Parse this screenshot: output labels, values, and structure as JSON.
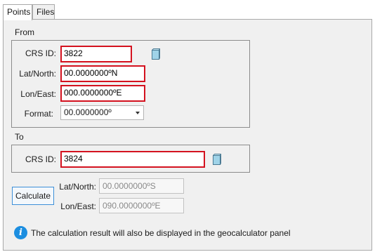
{
  "tabs": [
    {
      "label": "Points"
    },
    {
      "label": "Files"
    }
  ],
  "from": {
    "title": "From",
    "crs_label": "CRS  ID:",
    "crs_value": "3822",
    "lat_label": "Lat/North:",
    "lat_value": "00.0000000ºN",
    "lon_label": "Lon/East:",
    "lon_value": "000.0000000ºE",
    "format_label": "Format:",
    "format_value": "00.0000000º"
  },
  "to": {
    "title": "To",
    "crs_label": "CRS ID:",
    "crs_value": "3824"
  },
  "result": {
    "calculate_label": "Calculate",
    "lat_label": "Lat/North:",
    "lat_placeholder": "00.0000000ºS",
    "lon_label": "Lon/East:",
    "lon_placeholder": "090.0000000ºE"
  },
  "info": {
    "text": "The calculation result will also be displayed in the geocalculator panel"
  },
  "colors": {
    "highlight": "#d4121f",
    "info_icon": "#1c8ee0",
    "button_border": "#3c8fd8"
  },
  "icons": {
    "crs_picker": "cube-icon",
    "info": "info-icon"
  }
}
